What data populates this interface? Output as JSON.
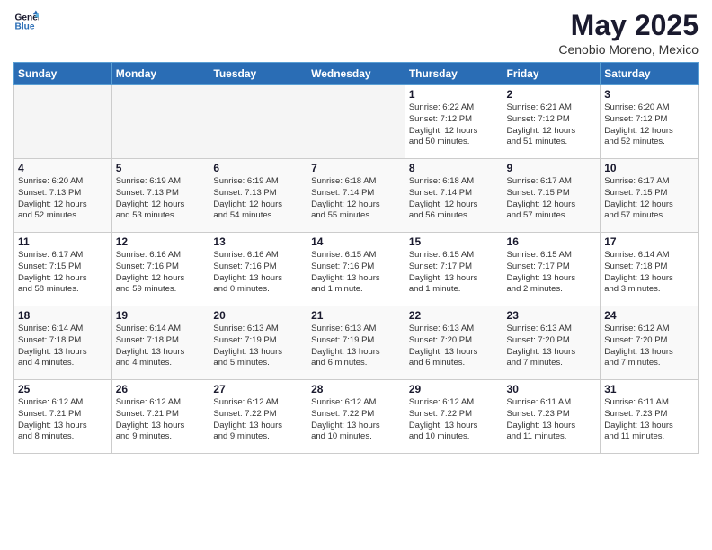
{
  "header": {
    "logo_line1": "General",
    "logo_line2": "Blue",
    "month": "May 2025",
    "location": "Cenobio Moreno, Mexico"
  },
  "weekdays": [
    "Sunday",
    "Monday",
    "Tuesday",
    "Wednesday",
    "Thursday",
    "Friday",
    "Saturday"
  ],
  "weeks": [
    [
      {
        "day": "",
        "info": ""
      },
      {
        "day": "",
        "info": ""
      },
      {
        "day": "",
        "info": ""
      },
      {
        "day": "",
        "info": ""
      },
      {
        "day": "1",
        "info": "Sunrise: 6:22 AM\nSunset: 7:12 PM\nDaylight: 12 hours\nand 50 minutes."
      },
      {
        "day": "2",
        "info": "Sunrise: 6:21 AM\nSunset: 7:12 PM\nDaylight: 12 hours\nand 51 minutes."
      },
      {
        "day": "3",
        "info": "Sunrise: 6:20 AM\nSunset: 7:12 PM\nDaylight: 12 hours\nand 52 minutes."
      }
    ],
    [
      {
        "day": "4",
        "info": "Sunrise: 6:20 AM\nSunset: 7:13 PM\nDaylight: 12 hours\nand 52 minutes."
      },
      {
        "day": "5",
        "info": "Sunrise: 6:19 AM\nSunset: 7:13 PM\nDaylight: 12 hours\nand 53 minutes."
      },
      {
        "day": "6",
        "info": "Sunrise: 6:19 AM\nSunset: 7:13 PM\nDaylight: 12 hours\nand 54 minutes."
      },
      {
        "day": "7",
        "info": "Sunrise: 6:18 AM\nSunset: 7:14 PM\nDaylight: 12 hours\nand 55 minutes."
      },
      {
        "day": "8",
        "info": "Sunrise: 6:18 AM\nSunset: 7:14 PM\nDaylight: 12 hours\nand 56 minutes."
      },
      {
        "day": "9",
        "info": "Sunrise: 6:17 AM\nSunset: 7:15 PM\nDaylight: 12 hours\nand 57 minutes."
      },
      {
        "day": "10",
        "info": "Sunrise: 6:17 AM\nSunset: 7:15 PM\nDaylight: 12 hours\nand 57 minutes."
      }
    ],
    [
      {
        "day": "11",
        "info": "Sunrise: 6:17 AM\nSunset: 7:15 PM\nDaylight: 12 hours\nand 58 minutes."
      },
      {
        "day": "12",
        "info": "Sunrise: 6:16 AM\nSunset: 7:16 PM\nDaylight: 12 hours\nand 59 minutes."
      },
      {
        "day": "13",
        "info": "Sunrise: 6:16 AM\nSunset: 7:16 PM\nDaylight: 13 hours\nand 0 minutes."
      },
      {
        "day": "14",
        "info": "Sunrise: 6:15 AM\nSunset: 7:16 PM\nDaylight: 13 hours\nand 1 minute."
      },
      {
        "day": "15",
        "info": "Sunrise: 6:15 AM\nSunset: 7:17 PM\nDaylight: 13 hours\nand 1 minute."
      },
      {
        "day": "16",
        "info": "Sunrise: 6:15 AM\nSunset: 7:17 PM\nDaylight: 13 hours\nand 2 minutes."
      },
      {
        "day": "17",
        "info": "Sunrise: 6:14 AM\nSunset: 7:18 PM\nDaylight: 13 hours\nand 3 minutes."
      }
    ],
    [
      {
        "day": "18",
        "info": "Sunrise: 6:14 AM\nSunset: 7:18 PM\nDaylight: 13 hours\nand 4 minutes."
      },
      {
        "day": "19",
        "info": "Sunrise: 6:14 AM\nSunset: 7:18 PM\nDaylight: 13 hours\nand 4 minutes."
      },
      {
        "day": "20",
        "info": "Sunrise: 6:13 AM\nSunset: 7:19 PM\nDaylight: 13 hours\nand 5 minutes."
      },
      {
        "day": "21",
        "info": "Sunrise: 6:13 AM\nSunset: 7:19 PM\nDaylight: 13 hours\nand 6 minutes."
      },
      {
        "day": "22",
        "info": "Sunrise: 6:13 AM\nSunset: 7:20 PM\nDaylight: 13 hours\nand 6 minutes."
      },
      {
        "day": "23",
        "info": "Sunrise: 6:13 AM\nSunset: 7:20 PM\nDaylight: 13 hours\nand 7 minutes."
      },
      {
        "day": "24",
        "info": "Sunrise: 6:12 AM\nSunset: 7:20 PM\nDaylight: 13 hours\nand 7 minutes."
      }
    ],
    [
      {
        "day": "25",
        "info": "Sunrise: 6:12 AM\nSunset: 7:21 PM\nDaylight: 13 hours\nand 8 minutes."
      },
      {
        "day": "26",
        "info": "Sunrise: 6:12 AM\nSunset: 7:21 PM\nDaylight: 13 hours\nand 9 minutes."
      },
      {
        "day": "27",
        "info": "Sunrise: 6:12 AM\nSunset: 7:22 PM\nDaylight: 13 hours\nand 9 minutes."
      },
      {
        "day": "28",
        "info": "Sunrise: 6:12 AM\nSunset: 7:22 PM\nDaylight: 13 hours\nand 10 minutes."
      },
      {
        "day": "29",
        "info": "Sunrise: 6:12 AM\nSunset: 7:22 PM\nDaylight: 13 hours\nand 10 minutes."
      },
      {
        "day": "30",
        "info": "Sunrise: 6:11 AM\nSunset: 7:23 PM\nDaylight: 13 hours\nand 11 minutes."
      },
      {
        "day": "31",
        "info": "Sunrise: 6:11 AM\nSunset: 7:23 PM\nDaylight: 13 hours\nand 11 minutes."
      }
    ]
  ]
}
